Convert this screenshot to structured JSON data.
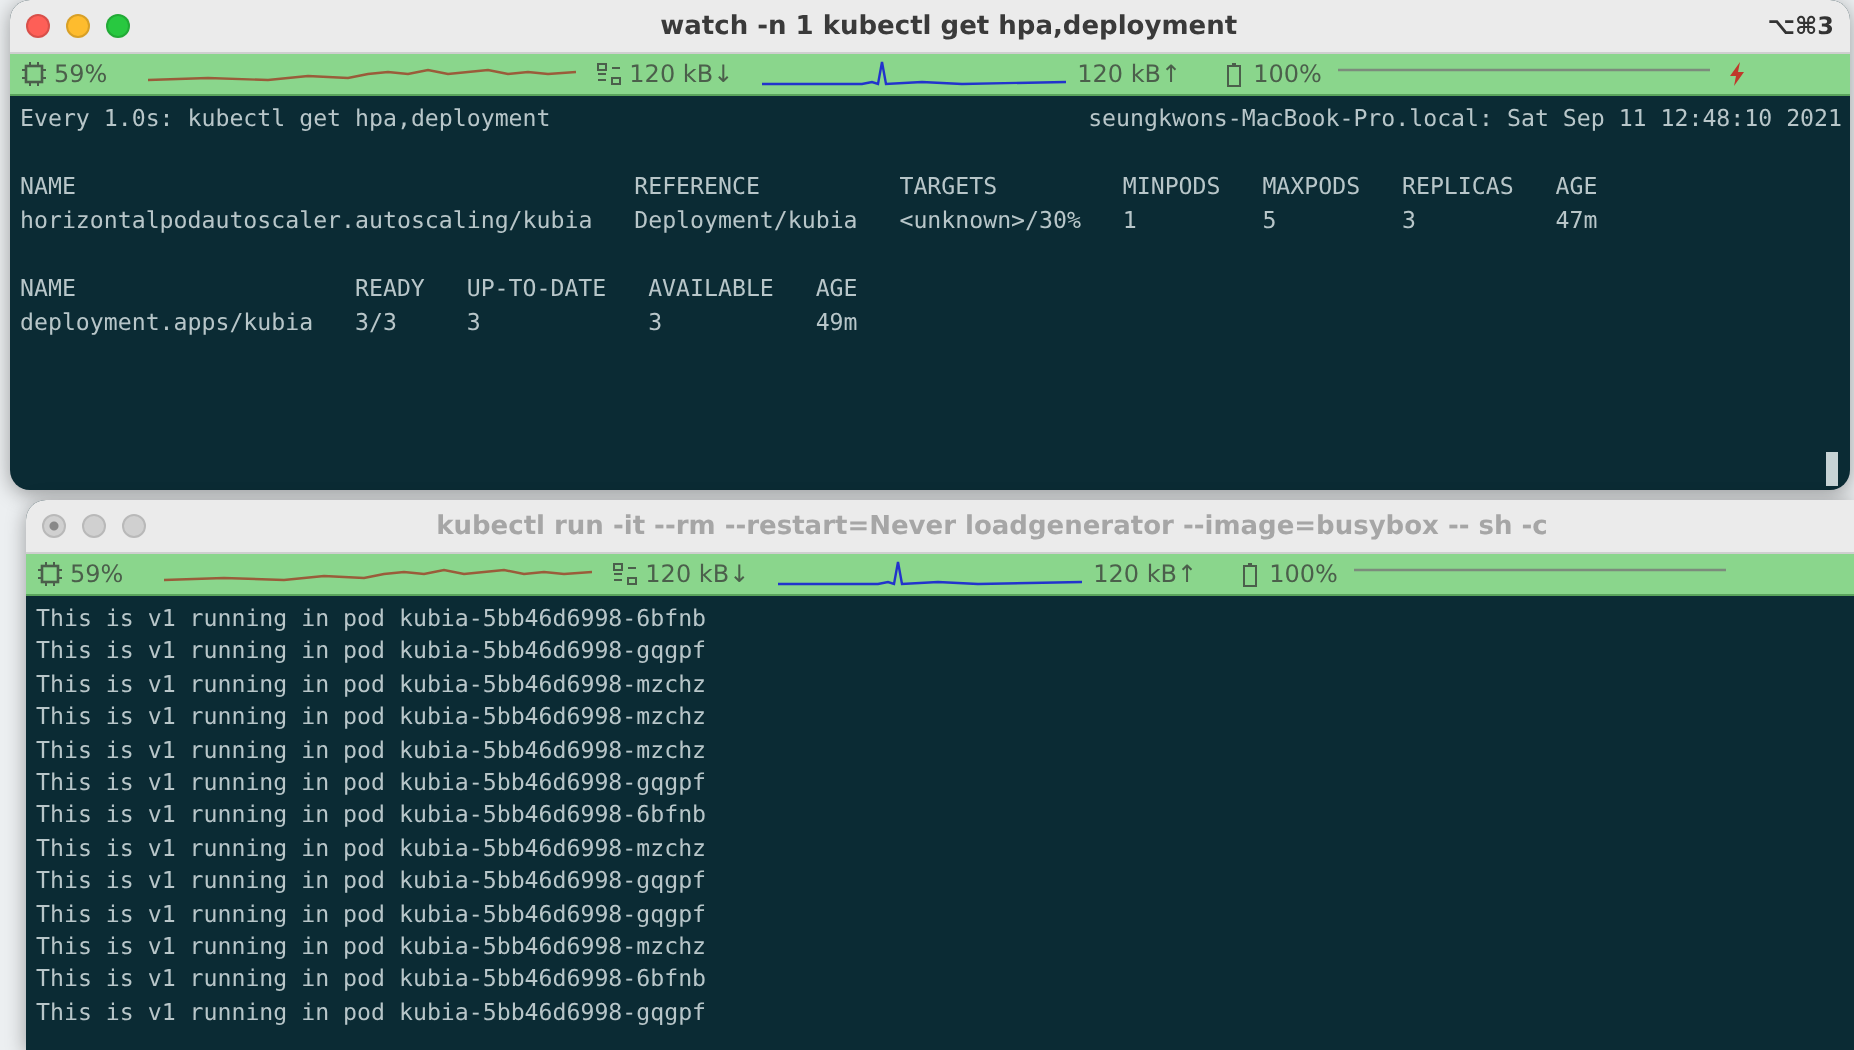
{
  "windows": [
    {
      "title": "watch -n 1 kubectl get hpa,deployment",
      "shortcut": "⌥⌘3",
      "focused": true,
      "status_bar": {
        "cpu": "59%",
        "download": "120 kB↓",
        "upload": "120 kB↑",
        "battery": "100%",
        "charging": true
      },
      "header": {
        "command": "Every 1.0s: kubectl get hpa,deployment",
        "host_time": "seungkwons-MacBook-Pro.local: Sat Sep 11 12:48:10 2021"
      },
      "tables": [
        {
          "columns": [
            "NAME",
            "REFERENCE",
            "TARGETS",
            "MINPODS",
            "MAXPODS",
            "REPLICAS",
            "AGE"
          ],
          "rows": [
            [
              "horizontalpodautoscaler.autoscaling/kubia",
              "Deployment/kubia",
              "<unknown>/30%",
              "1",
              "5",
              "3",
              "47m"
            ]
          ]
        },
        {
          "columns": [
            "NAME",
            "READY",
            "UP-TO-DATE",
            "AVAILABLE",
            "AGE"
          ],
          "rows": [
            [
              "deployment.apps/kubia",
              "3/3",
              "3",
              "3",
              "49m"
            ]
          ]
        }
      ]
    },
    {
      "title": "kubectl run -it --rm --restart=Never loadgenerator --image=busybox -- sh -c",
      "focused": false,
      "status_bar": {
        "cpu": "59%",
        "download": "120 kB↓",
        "upload": "120 kB↑",
        "battery": "100%"
      },
      "lines": [
        "This is v1 running in pod kubia-5bb46d6998-6bfnb",
        "This is v1 running in pod kubia-5bb46d6998-gqgpf",
        "This is v1 running in pod kubia-5bb46d6998-mzchz",
        "This is v1 running in pod kubia-5bb46d6998-mzchz",
        "This is v1 running in pod kubia-5bb46d6998-mzchz",
        "This is v1 running in pod kubia-5bb46d6998-gqgpf",
        "This is v1 running in pod kubia-5bb46d6998-6bfnb",
        "This is v1 running in pod kubia-5bb46d6998-mzchz",
        "This is v1 running in pod kubia-5bb46d6998-gqgpf",
        "This is v1 running in pod kubia-5bb46d6998-gqgpf",
        "This is v1 running in pod kubia-5bb46d6998-mzchz",
        "This is v1 running in pod kubia-5bb46d6998-6bfnb",
        "This is v1 running in pod kubia-5bb46d6998-gqgpf"
      ]
    }
  ]
}
